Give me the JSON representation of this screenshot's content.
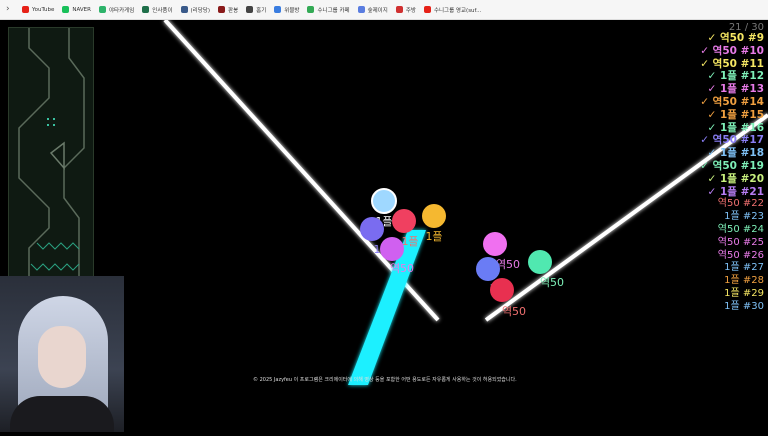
{
  "bookmarks": [
    {
      "label": "YouTube",
      "color": "#e62117"
    },
    {
      "label": "NAVER",
      "color": "#19c05a"
    },
    {
      "label": "야타카게임",
      "color": "#2db36a"
    },
    {
      "label": "인사품이",
      "color": "#1f6f4a"
    },
    {
      "label": "(리당당)",
      "color": "#3a5a8a"
    },
    {
      "label": "판봉",
      "color": "#8a1a1a"
    },
    {
      "label": "홈기",
      "color": "#444444"
    },
    {
      "label": "위블방",
      "color": "#3a7de0"
    },
    {
      "label": "수니그룹 카페",
      "color": "#33aa55"
    },
    {
      "label": "숲제이지",
      "color": "#5a7de0"
    },
    {
      "label": "주방",
      "color": "#d03030"
    },
    {
      "label": "수니그룹 영교(suf...",
      "color": "#e62117"
    }
  ],
  "game": {
    "counter": "21 / 30",
    "leaderboard": [
      {
        "mark": "✓",
        "text": "역50 #9",
        "color": "#f5e663"
      },
      {
        "mark": "✓",
        "text": "역50 #10",
        "color": "#e87be8"
      },
      {
        "mark": "✓",
        "text": "역50 #11",
        "color": "#f5e663"
      },
      {
        "mark": "✓",
        "text": "1플 #12",
        "color": "#7ef0b8"
      },
      {
        "mark": "✓",
        "text": "1플 #13",
        "color": "#e87be8"
      },
      {
        "mark": "✓",
        "text": "역50 #14",
        "color": "#f0a040"
      },
      {
        "mark": "✓",
        "text": "1플 #15",
        "color": "#f0a040"
      },
      {
        "mark": "✓",
        "text": "1플 #16",
        "color": "#7ef0b8"
      },
      {
        "mark": "✓",
        "text": "역50 #17",
        "color": "#8a7ef5"
      },
      {
        "mark": "✓",
        "text": "1플 #18",
        "color": "#7ec0f5"
      },
      {
        "mark": "✓",
        "text": "역50 #19",
        "color": "#7ef0b8"
      },
      {
        "mark": "✓",
        "text": "1플 #20",
        "color": "#c8f07e"
      },
      {
        "mark": "✓",
        "text": "1플 #21",
        "color": "#b87ef5"
      },
      {
        "mark": "",
        "text": "역50 #22",
        "color": "#f07070"
      },
      {
        "mark": "",
        "text": "1플 #23",
        "color": "#7ec0f5"
      },
      {
        "mark": "",
        "text": "역50 #24",
        "color": "#7ef0b8"
      },
      {
        "mark": "",
        "text": "역50 #25",
        "color": "#e87be8"
      },
      {
        "mark": "",
        "text": "역50 #26",
        "color": "#e87be8"
      },
      {
        "mark": "",
        "text": "1플 #27",
        "color": "#7ec0f5"
      },
      {
        "mark": "",
        "text": "1플 #28",
        "color": "#f0a040"
      },
      {
        "mark": "",
        "text": "1플 #29",
        "color": "#f5e663"
      },
      {
        "mark": "",
        "text": "1플 #30",
        "color": "#7ec0f5"
      }
    ],
    "balls": [
      {
        "label": "1플",
        "color": "#9fd8ff",
        "label_color": "#ffffff"
      },
      {
        "label": "1플",
        "color": "#f04060",
        "label_color": "#f07070"
      },
      {
        "label": "1플",
        "color": "#f5b830",
        "label_color": "#f5b830"
      },
      {
        "label": "1플",
        "color": "#7a6cf0",
        "label_color": "#8a7ef5"
      },
      {
        "label": "역50",
        "color": "#d060f0",
        "label_color": "#e87be8"
      },
      {
        "label": "역50",
        "color": "#f070f0",
        "label_color": "#e87be8"
      },
      {
        "label": "1플",
        "color": "#6a7cf5",
        "label_color": "#7ec0f5"
      },
      {
        "label": "역50",
        "color": "#e83050",
        "label_color": "#f07070"
      },
      {
        "label": "역50",
        "color": "#50e8b0",
        "label_color": "#7ef0b8"
      }
    ],
    "footer": "© 2025 Jazyfeu 이 프로그램은 크리에이터에 의해 영상 등을 포함한 어떤 용도로든 자유롭게 사용하는 것이 허용되었습니다."
  }
}
